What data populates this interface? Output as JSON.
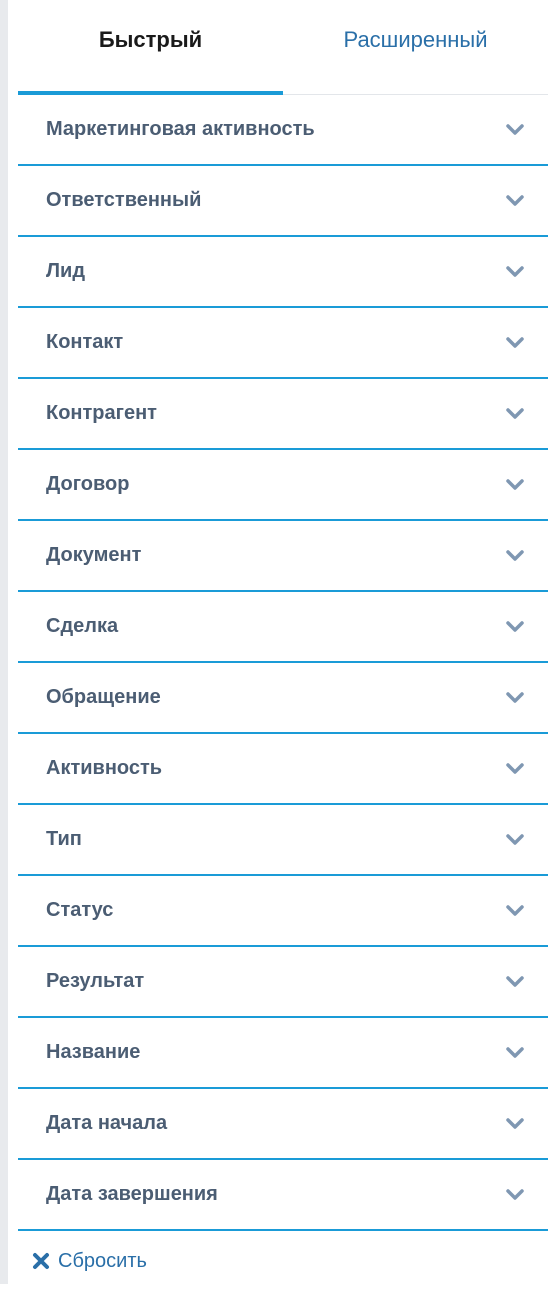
{
  "tabs": {
    "quick": "Быстрый",
    "advanced": "Расширенный",
    "active": "quick"
  },
  "filters": [
    {
      "label": "Маркетинговая активность",
      "icon": "chevron-down-icon"
    },
    {
      "label": "Ответственный",
      "icon": "chevron-down-icon"
    },
    {
      "label": "Лид",
      "icon": "chevron-down-icon"
    },
    {
      "label": "Контакт",
      "icon": "chevron-down-icon"
    },
    {
      "label": "Контрагент",
      "icon": "chevron-down-icon"
    },
    {
      "label": "Договор",
      "icon": "chevron-down-icon"
    },
    {
      "label": "Документ",
      "icon": "chevron-down-icon"
    },
    {
      "label": "Сделка",
      "icon": "chevron-down-icon"
    },
    {
      "label": "Обращение",
      "icon": "chevron-down-icon"
    },
    {
      "label": "Активность",
      "icon": "chevron-down-icon"
    },
    {
      "label": "Тип",
      "icon": "chevron-down-icon"
    },
    {
      "label": "Статус",
      "icon": "chevron-down-icon"
    },
    {
      "label": "Результат",
      "icon": "chevron-down-icon"
    },
    {
      "label": "Название",
      "icon": "chevron-down-icon"
    },
    {
      "label": "Дата начала",
      "icon": "chevron-down-icon"
    },
    {
      "label": "Дата завершения",
      "icon": "chevron-down-icon"
    }
  ],
  "reset": {
    "label": "Сбросить",
    "icon": "close-icon"
  },
  "colors": {
    "accent": "#1a9bd7",
    "label": "#4b5d73",
    "link": "#2a6fa8",
    "chevron": "#7f97b2"
  }
}
